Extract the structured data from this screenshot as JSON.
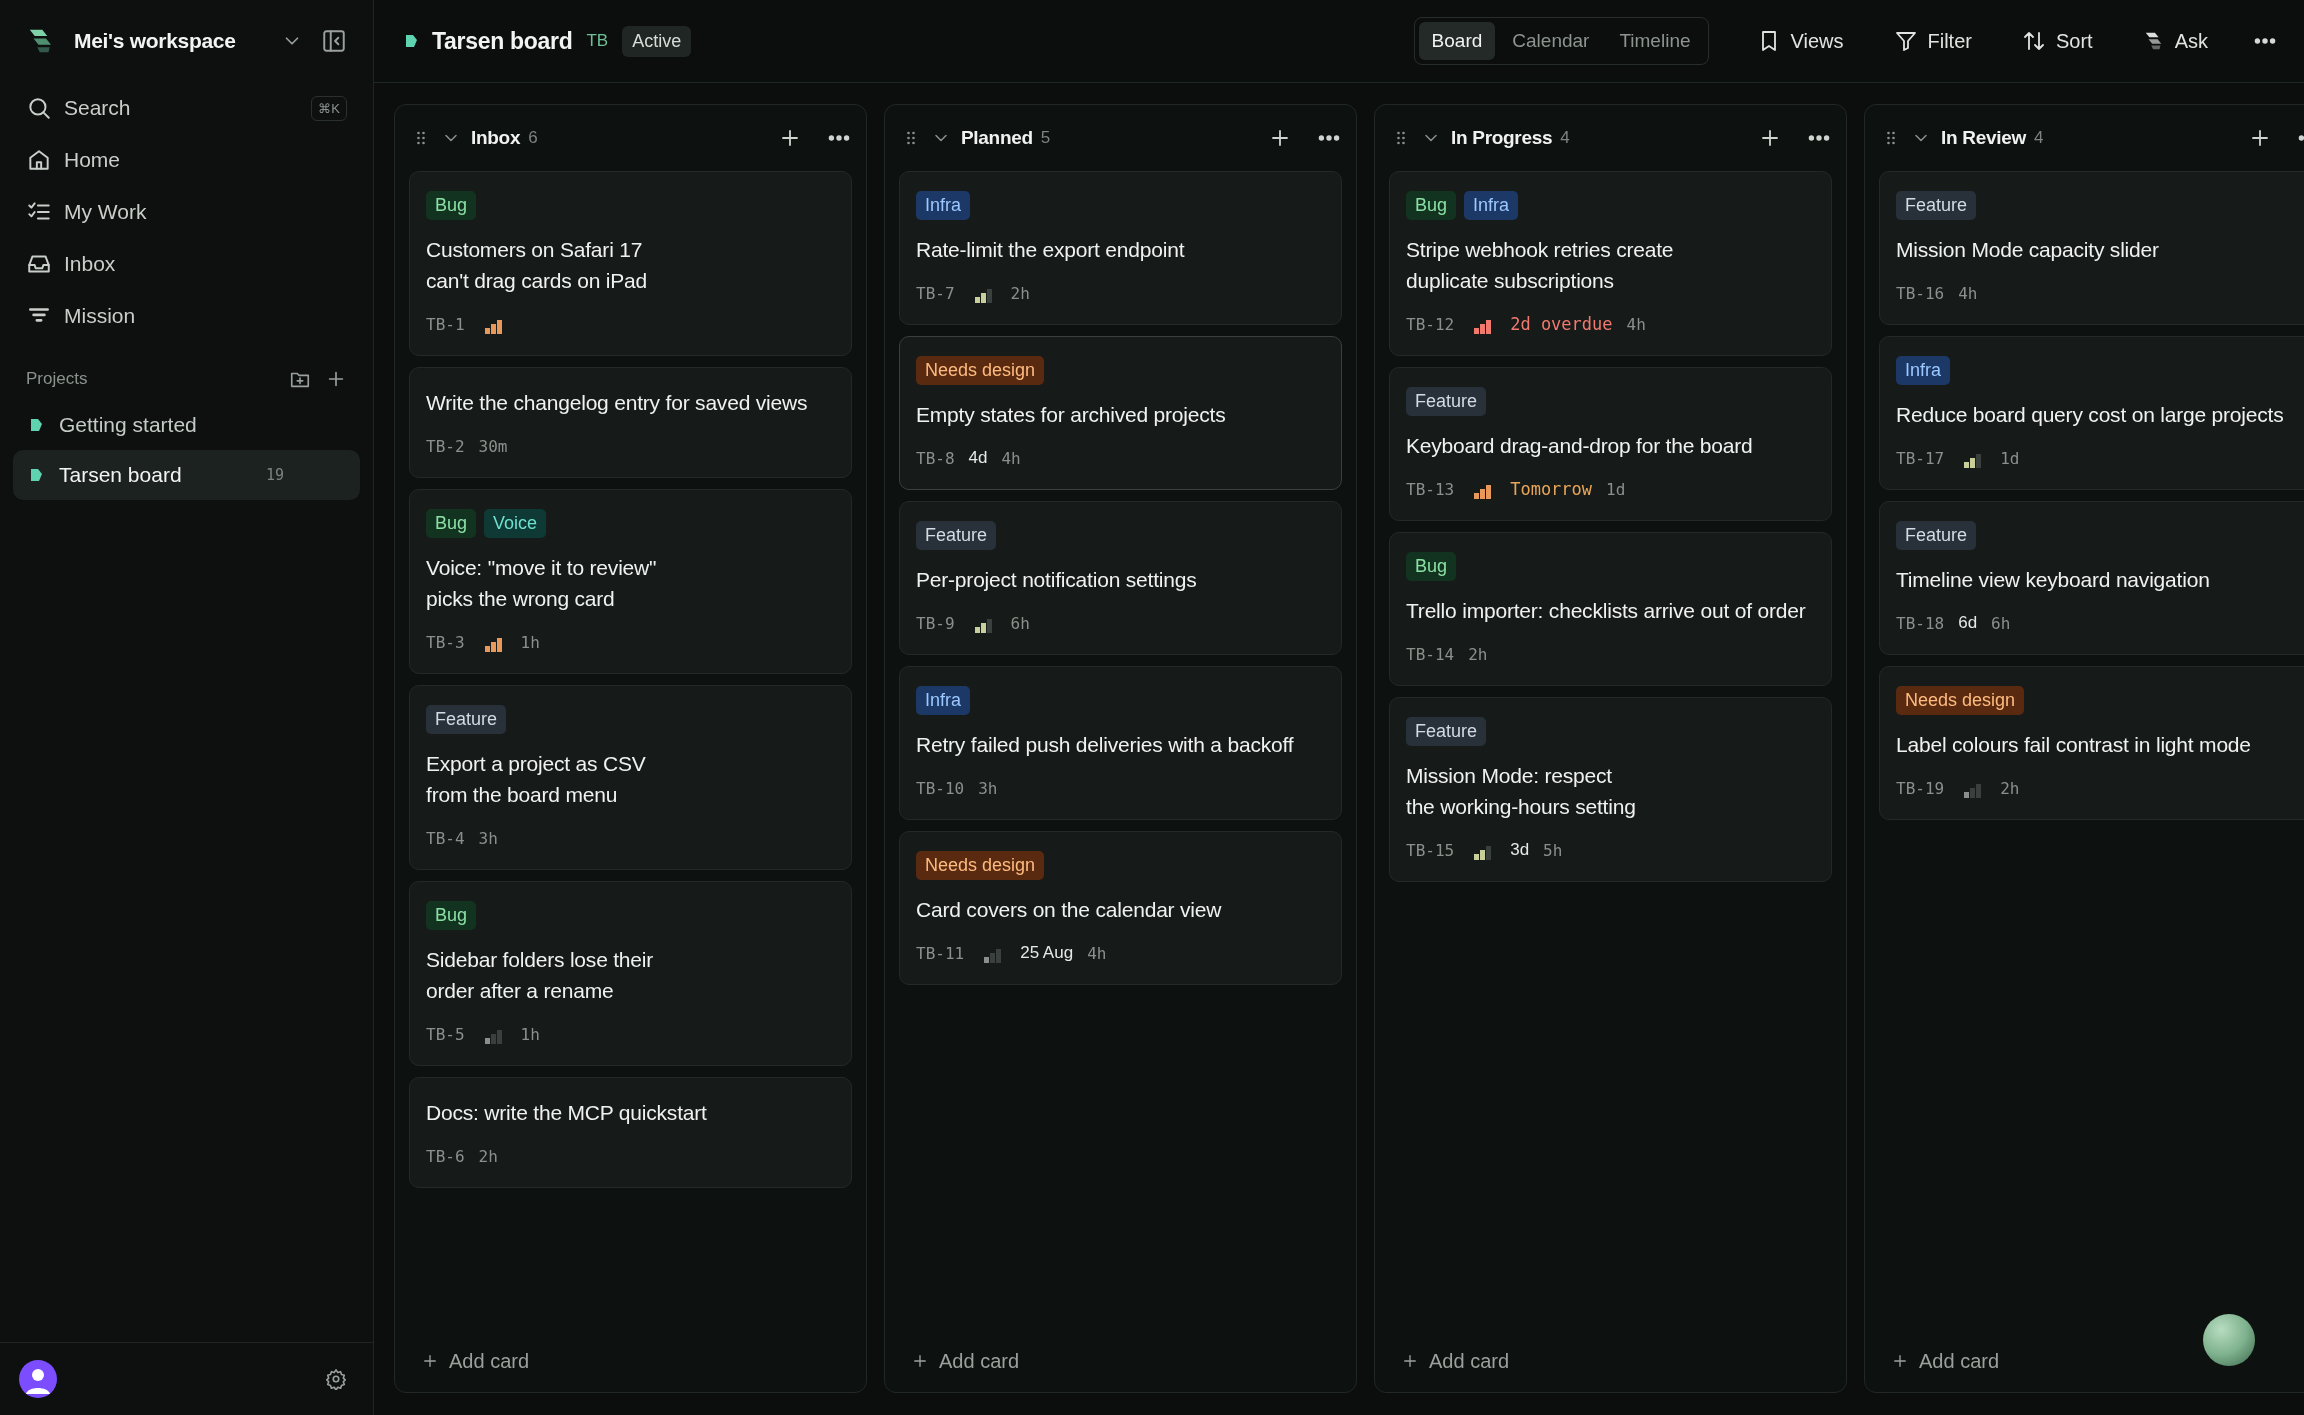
{
  "sidebar": {
    "workspace": "Mei's workspace",
    "search": {
      "label": "Search",
      "shortcut": "⌘K"
    },
    "nav": [
      {
        "label": "Home",
        "selected": false
      },
      {
        "label": "My Work",
        "selected": false
      },
      {
        "label": "Inbox",
        "selected": false
      },
      {
        "label": "Mission",
        "selected": false
      }
    ],
    "projects_heading": "Projects",
    "projects": [
      {
        "label": "Getting started",
        "selected": false
      },
      {
        "label": "Tarsen board",
        "count": "19",
        "selected": true
      }
    ]
  },
  "header": {
    "title": "Tarsen board",
    "key": "TB",
    "status": "Active",
    "views": [
      {
        "label": "Board",
        "selected": true
      },
      {
        "label": "Calendar",
        "selected": false
      },
      {
        "label": "Timeline",
        "selected": false
      }
    ],
    "actions": [
      "Views",
      "Filter",
      "Sort",
      "Ask"
    ]
  },
  "columns": [
    {
      "title": "Inbox",
      "count": "6",
      "add_label": "Add card",
      "cards": [
        {
          "id": "TB-1",
          "tags": [
            {
              "label": "Bug",
              "kind": "bug"
            }
          ],
          "title": "Customers on Safari 17 can't drag cards on iPad",
          "priority": {
            "kind": "high"
          },
          "hovered": false
        },
        {
          "id": "TB-2",
          "title": "Write the changelog entry for saved views",
          "estimate": "30m",
          "hovered": false
        },
        {
          "id": "TB-3",
          "tags": [
            {
              "label": "Bug",
              "kind": "bug"
            },
            {
              "label": "Voice",
              "kind": "voice"
            }
          ],
          "title": "Voice: \"move it to review\" picks the wrong card",
          "priority": {
            "kind": "high"
          },
          "estimate": "1h",
          "hovered": false
        },
        {
          "id": "TB-4",
          "tags": [
            {
              "label": "Feature",
              "kind": "feature"
            }
          ],
          "title": "Export a project as CSV from the board menu",
          "estimate": "3h",
          "hovered": false
        },
        {
          "id": "TB-5",
          "tags": [
            {
              "label": "Bug",
              "kind": "bug"
            }
          ],
          "title": "Sidebar folders lose their order after a rename",
          "priority": {
            "kind": "low"
          },
          "estimate": "1h",
          "hovered": false
        },
        {
          "id": "TB-6",
          "title": "Docs: write the MCP quickstart",
          "estimate": "2h",
          "hovered": false
        }
      ]
    },
    {
      "title": "Planned",
      "count": "5",
      "add_label": "Add card",
      "cards": [
        {
          "id": "TB-7",
          "tags": [
            {
              "label": "Infra",
              "kind": "infra"
            }
          ],
          "title": "Rate-limit the export endpoint",
          "priority": {
            "kind": "medium"
          },
          "estimate": "2h",
          "hovered": false
        },
        {
          "id": "TB-8",
          "tags": [
            {
              "label": "Needs design",
              "kind": "design"
            }
          ],
          "title": "Empty states for archived projects",
          "due": {
            "text": "4d",
            "kind": "normal"
          },
          "estimate": "4h",
          "hovered": true
        },
        {
          "id": "TB-9",
          "tags": [
            {
              "label": "Feature",
              "kind": "feature"
            }
          ],
          "title": "Per-project notification settings",
          "priority": {
            "kind": "medium"
          },
          "estimate": "6h",
          "hovered": false
        },
        {
          "id": "TB-10",
          "tags": [
            {
              "label": "Infra",
              "kind": "infra"
            }
          ],
          "title": "Retry failed push deliveries with a backoff",
          "estimate": "3h",
          "hovered": false
        },
        {
          "id": "TB-11",
          "tags": [
            {
              "label": "Needs design",
              "kind": "design"
            }
          ],
          "title": "Card covers on the calendar view",
          "priority": {
            "kind": "low"
          },
          "due": {
            "text": "25 Aug",
            "kind": "normal"
          },
          "estimate": "4h",
          "hovered": false
        }
      ]
    },
    {
      "title": "In Progress",
      "count": "4",
      "add_label": "Add card",
      "cards": [
        {
          "id": "TB-12",
          "tags": [
            {
              "label": "Bug",
              "kind": "bug"
            },
            {
              "label": "Infra",
              "kind": "infra"
            }
          ],
          "title": "Stripe webhook retries create duplicate subscriptions",
          "priority": {
            "kind": "urgent"
          },
          "due": {
            "text": "2d overdue",
            "kind": "overdue"
          },
          "estimate": "4h",
          "hovered": false
        },
        {
          "id": "TB-13",
          "tags": [
            {
              "label": "Feature",
              "kind": "feature"
            }
          ],
          "title": "Keyboard drag-and-drop for the board",
          "priority": {
            "kind": "high"
          },
          "due": {
            "text": "Tomorrow",
            "kind": "soon"
          },
          "estimate": "1d",
          "hovered": false
        },
        {
          "id": "TB-14",
          "tags": [
            {
              "label": "Bug",
              "kind": "bug"
            }
          ],
          "title": "Trello importer: checklists arrive out of order",
          "estimate": "2h",
          "hovered": false
        },
        {
          "id": "TB-15",
          "tags": [
            {
              "label": "Feature",
              "kind": "feature"
            }
          ],
          "title": "Mission Mode: respect the working-hours setting",
          "priority": {
            "kind": "medium"
          },
          "due": {
            "text": "3d",
            "kind": "normal"
          },
          "estimate": "5h",
          "hovered": false
        }
      ]
    },
    {
      "title": "In Review",
      "count": "4",
      "add_label": "Add card",
      "cards": [
        {
          "id": "TB-16",
          "tags": [
            {
              "label": "Feature",
              "kind": "feature"
            }
          ],
          "title": "Mission Mode capacity slider",
          "estimate": "4h",
          "hovered": false
        },
        {
          "id": "TB-17",
          "tags": [
            {
              "label": "Infra",
              "kind": "infra"
            }
          ],
          "title": "Reduce board query cost on large projects",
          "priority": {
            "kind": "medium"
          },
          "estimate": "1d",
          "hovered": false
        },
        {
          "id": "TB-18",
          "tags": [
            {
              "label": "Feature",
              "kind": "feature"
            }
          ],
          "title": "Timeline view keyboard navigation",
          "due": {
            "text": "6d",
            "kind": "normal"
          },
          "estimate": "6h",
          "hovered": false
        },
        {
          "id": "TB-19",
          "tags": [
            {
              "label": "Needs design",
              "kind": "design"
            }
          ],
          "title": "Label colours fail contrast in light mode",
          "priority": {
            "kind": "low"
          },
          "estimate": "2h",
          "hovered": false
        }
      ]
    }
  ]
}
